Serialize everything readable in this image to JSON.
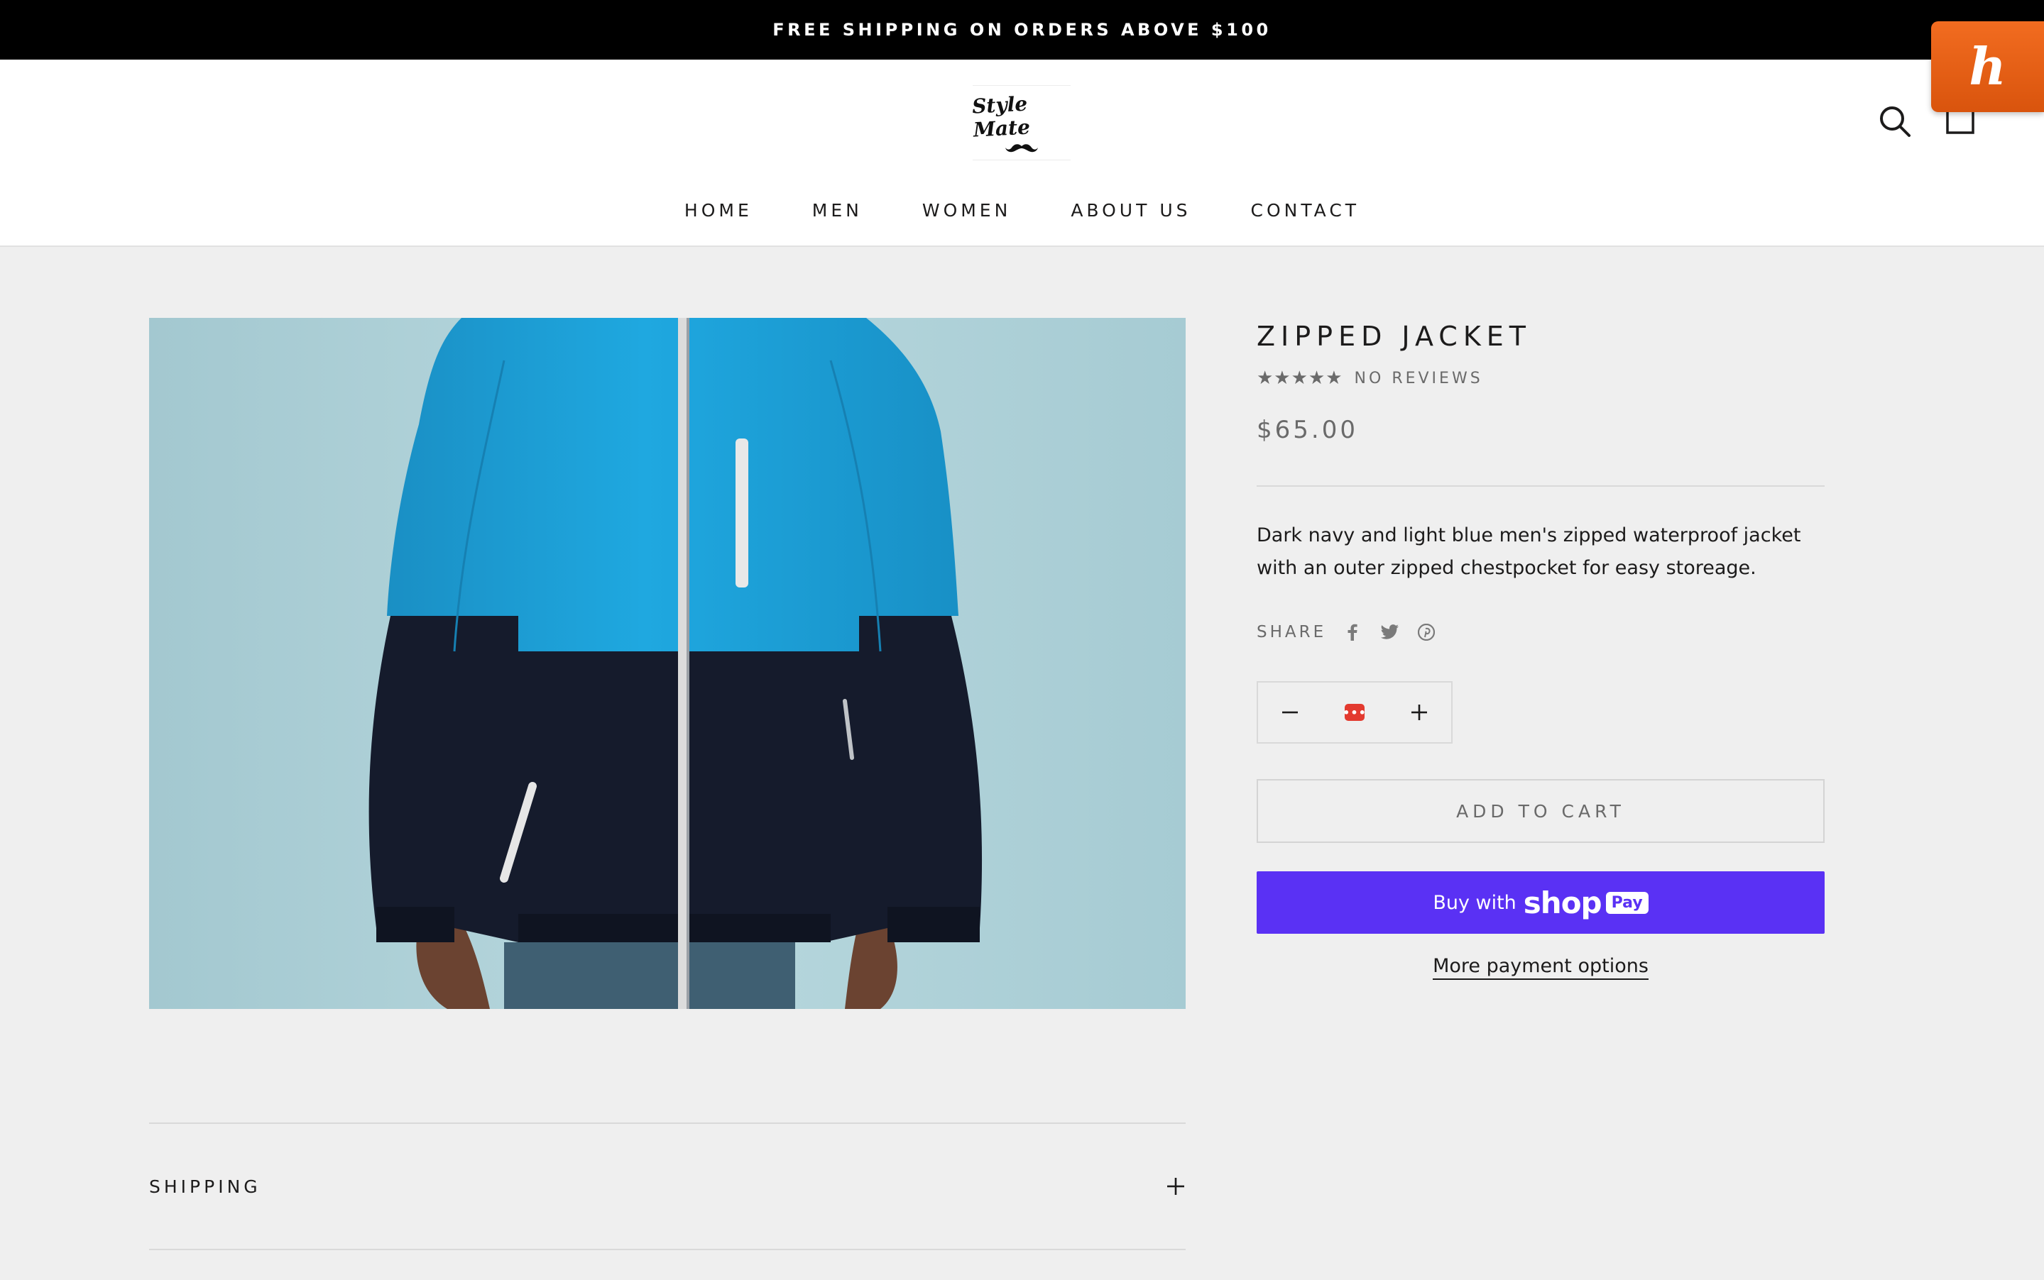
{
  "announcement": "FREE SHIPPING ON ORDERS ABOVE $100",
  "brand": {
    "name": "Style Mate",
    "logo_icon": "mustache-icon"
  },
  "nav": {
    "items": [
      {
        "label": "HOME"
      },
      {
        "label": "MEN"
      },
      {
        "label": "WOMEN"
      },
      {
        "label": "ABOUT US"
      },
      {
        "label": "CONTACT"
      }
    ]
  },
  "header_icons": [
    "search-icon",
    "cart-icon"
  ],
  "extension": {
    "name": "honey",
    "glyph": "h",
    "color": "#e8621a"
  },
  "product": {
    "title": "ZIPPED JACKET",
    "stars": "★★★★★",
    "reviews": "NO REVIEWS",
    "price": "$65.00",
    "description": "Dark navy and light blue men's zipped waterproof jacket with an outer zipped chestpocket for easy storeage.",
    "share_label": "SHARE",
    "share_icons": [
      "facebook-icon",
      "twitter-icon",
      "pinterest-icon"
    ],
    "quantity_display": "•••",
    "add_to_cart": "ADD TO CART",
    "buy_with": "Buy with",
    "shop": "shop",
    "pay": "Pay",
    "more_payment": "More payment options"
  },
  "accordion": {
    "shipping_label": "SHIPPING"
  },
  "colors": {
    "announcement_bg": "#000000",
    "page_bg": "#efefef",
    "shop_pay": "#5a31f4",
    "jacket_blue": "#1e9fd6",
    "jacket_navy": "#141a2b",
    "photo_bg": "#a9cdd5"
  }
}
